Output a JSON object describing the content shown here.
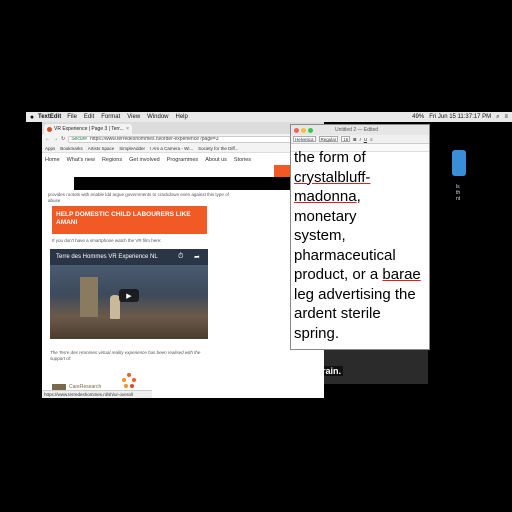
{
  "menubar": {
    "app": "TextEdit",
    "items": [
      "File",
      "Edit",
      "Format",
      "View",
      "Window",
      "Help"
    ],
    "clock": "Fri Jun 15  11:37:17 PM",
    "battery": "49%"
  },
  "browser": {
    "tab_title": "VR Experience | Page 3 | Terr...",
    "url_secure": "Secure",
    "url": "https://www.terredeshommes.nl/order-experience?page=3",
    "bookmarks": [
      "Apps",
      "Bookmarks",
      "Artists Space",
      "SimpleAdder",
      "I Am a Camera - Wi...",
      "Society for the Diff..."
    ],
    "nav": [
      "Home",
      "What's new",
      "Regions",
      "Get involved",
      "Programmes",
      "About us",
      "Stories"
    ],
    "partial_text": "provides rootots with enable ldd argue governments to crackdown even against this type of abuse.",
    "cta": "HELP DOMESTIC CHILD LABOURERS LIKE AMANI",
    "smartphone_text": "If you don't have a smartphone watch the VR film here:",
    "video_title": "Terre des Hommes VR Experience NL",
    "caption": "The Terre des Hommes virtual reality experience has been realised with the support of:",
    "logo_text": "CareResearch",
    "status_url": "https://www.terredeshommes.nl/sh/ur-overall"
  },
  "textedit": {
    "title": "Untitled 2 — Edited",
    "toolbar": [
      "Helvetica",
      "Regular",
      "16"
    ],
    "lines": [
      {
        "text": "the form of",
        "err": false
      },
      {
        "text": "crystalbluff-",
        "err": true
      },
      {
        "text": "madonna",
        "err": true,
        "suffix": ", monetary"
      },
      {
        "text": "system,",
        "err": false
      },
      {
        "text": "pharmaceutical",
        "err": false
      },
      {
        "text": "product, or a ",
        "err": false,
        "tail_err": "barae"
      },
      {
        "text": "leg advertising the",
        "err": false
      },
      {
        "text": "ardent sterile spring.",
        "err": false
      }
    ]
  },
  "background": {
    "video_caption": "rain.",
    "desktop_label": "ls\nth\nnt"
  },
  "colors": {
    "brand_orange": "#f15a24",
    "spell_error": "#e02020"
  }
}
